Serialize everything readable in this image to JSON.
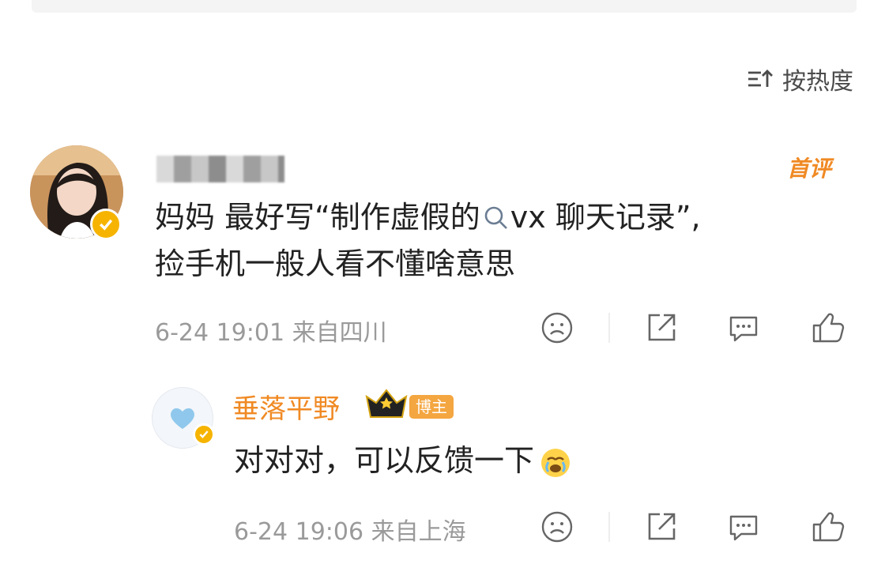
{
  "sort": {
    "label": "按热度"
  },
  "comment": {
    "tag": "首评",
    "content_before": "妈妈 最好写“制作虚假的",
    "content_link": "vx 聊天记录",
    "content_after": "”,",
    "content_line2": "捡手机一般人看不懂啥意思",
    "time": "6-24 19:01",
    "location": "来自四川"
  },
  "reply": {
    "name": "垂落平野",
    "host_tag": "博主",
    "content": "对对对，可以反馈一下",
    "time": "6-24 19:06",
    "location": "来自上海"
  },
  "colors": {
    "accent": "#f08a24",
    "meta": "#9a9a9a",
    "verified": "#f6b400"
  },
  "icons": [
    "sort-icon",
    "search-icon",
    "verified-icon",
    "sad-face-icon",
    "share-icon",
    "comment-icon",
    "like-icon",
    "crown-icon",
    "crying-emoji-icon",
    "heart-icon"
  ]
}
